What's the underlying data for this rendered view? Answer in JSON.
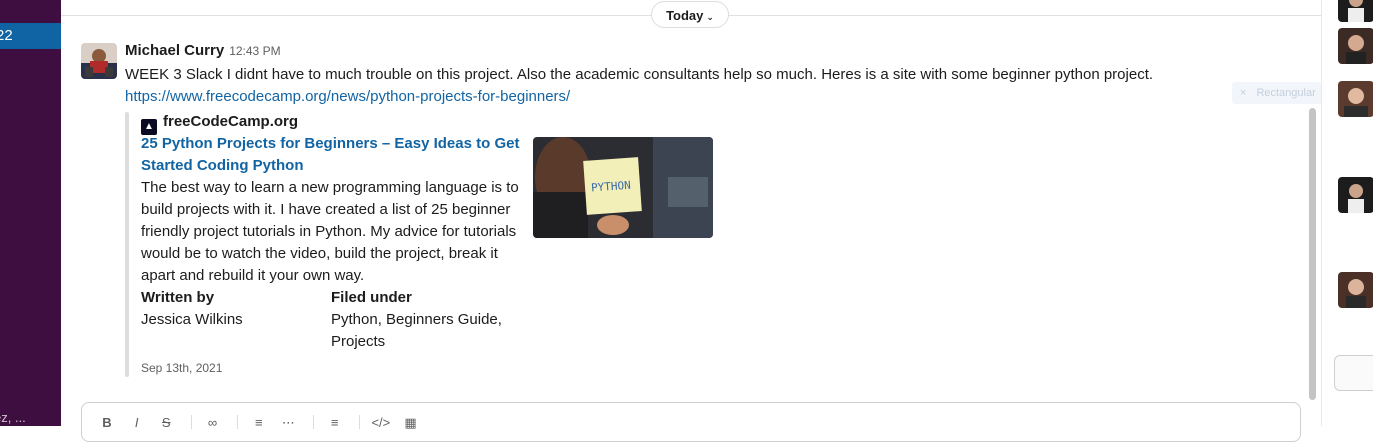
{
  "sidebar": {
    "active_item_label": "22",
    "bottom_label": "ez, ..."
  },
  "divider": {
    "label": "Today"
  },
  "message": {
    "author": "Michael Curry",
    "time": "12:43 PM",
    "text": "WEEK 3 Slack I didnt have to much trouble on this project. Also the academic consultants help so much. Heres is a site with some beginner python project.",
    "link": "https://www.freecodecamp.org/news/python-projects-for-beginners/"
  },
  "unfurl": {
    "site": "freeCodeCamp.org",
    "title": "25 Python Projects for Beginners – Easy Ideas to Get Started Coding Python",
    "description": "The best way to learn a new programming language is to build projects with it. I have created a list of 25 beginner friendly project tutorials in Python. My advice for tutorials would be to watch the video, build the project, break it apart and rebuild it your own way.",
    "written_by_label": "Written by",
    "written_by_value": "Jessica Wilkins",
    "filed_under_label": "Filed under",
    "filed_under_value": "Python, Beginners Guide, Projects",
    "date": "Sep 13th, 2021",
    "thumb_text": "PYTHON"
  },
  "overlay": {
    "ghost_label": "Rectangular"
  },
  "composer": {
    "toolbar": [
      "bold-icon",
      "italic-icon",
      "strikethrough-icon",
      "link-icon",
      "ordered-list-icon",
      "bullet-list-icon",
      "blockquote-icon",
      "code-icon",
      "code-block-icon"
    ]
  },
  "colors": {
    "sidebar": "#3f0e40",
    "active": "#1164a3",
    "link": "#1264a3"
  }
}
